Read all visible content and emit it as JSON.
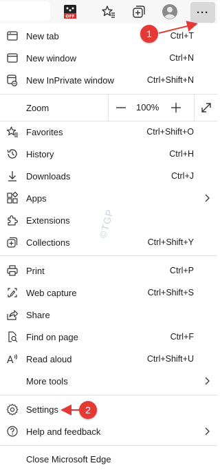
{
  "toolbar": {
    "badge_text": "OFF",
    "icons": [
      "extension-off-icon",
      "favorites-icon",
      "collections-icon",
      "profile-icon"
    ],
    "more_label": "···"
  },
  "menu": {
    "group1": [
      {
        "label": "New tab",
        "shortcut": "Ctrl+T",
        "icon": "new-tab-icon"
      },
      {
        "label": "New window",
        "shortcut": "Ctrl+N",
        "icon": "new-window-icon"
      },
      {
        "label": "New InPrivate window",
        "shortcut": "Ctrl+Shift+N",
        "icon": "inprivate-icon"
      }
    ],
    "zoom": {
      "label": "Zoom",
      "value": "100%"
    },
    "group2": [
      {
        "label": "Favorites",
        "shortcut": "Ctrl+Shift+O",
        "icon": "favorites-icon"
      },
      {
        "label": "History",
        "shortcut": "Ctrl+H",
        "icon": "history-icon"
      },
      {
        "label": "Downloads",
        "shortcut": "Ctrl+J",
        "icon": "downloads-icon"
      },
      {
        "label": "Apps",
        "shortcut": "",
        "icon": "apps-icon",
        "submenu": true
      },
      {
        "label": "Extensions",
        "shortcut": "",
        "icon": "extensions-icon"
      },
      {
        "label": "Collections",
        "shortcut": "Ctrl+Shift+Y",
        "icon": "collections-icon"
      }
    ],
    "group3": [
      {
        "label": "Print",
        "shortcut": "Ctrl+P",
        "icon": "print-icon"
      },
      {
        "label": "Web capture",
        "shortcut": "Ctrl+Shift+S",
        "icon": "web-capture-icon"
      },
      {
        "label": "Share",
        "shortcut": "",
        "icon": "share-icon"
      },
      {
        "label": "Find on page",
        "shortcut": "Ctrl+F",
        "icon": "find-icon"
      },
      {
        "label": "Read aloud",
        "shortcut": "Ctrl+Shift+U",
        "icon": "read-aloud-icon"
      },
      {
        "label": "More tools",
        "shortcut": "",
        "icon": "",
        "submenu": true
      }
    ],
    "group4": [
      {
        "label": "Settings",
        "shortcut": "",
        "icon": "settings-icon"
      },
      {
        "label": "Help and feedback",
        "shortcut": "",
        "icon": "help-icon",
        "submenu": true
      }
    ],
    "group5": [
      {
        "label": "Close Microsoft Edge",
        "shortcut": "",
        "icon": ""
      }
    ]
  },
  "callouts": {
    "first": "1",
    "second": "2"
  },
  "watermark": "©TGP",
  "colors": {
    "accent_red": "#e53935",
    "more_button_bg": "#d9d9d9",
    "separator": "#e3e3e3"
  }
}
